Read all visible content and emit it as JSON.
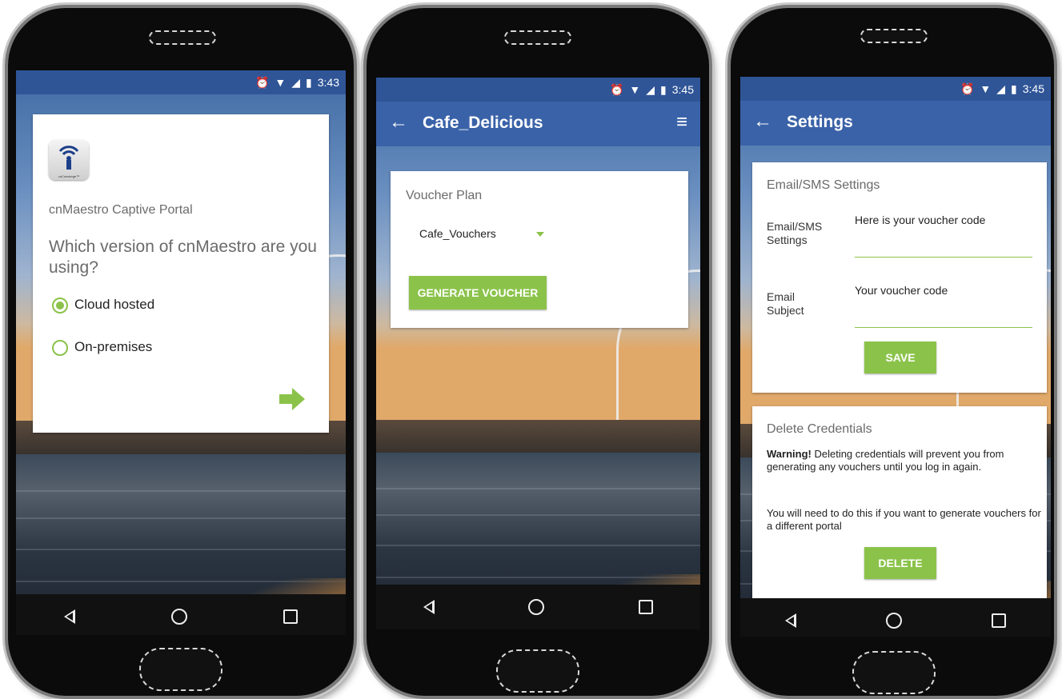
{
  "colors": {
    "app_bar": "#3a62a8",
    "status_bar": "#2f5597",
    "accent_green": "#8bc34a"
  },
  "phone1": {
    "status_time": "3:43",
    "icons": [
      "alarm-icon",
      "wifi-icon",
      "signal-icon",
      "battery-icon"
    ],
    "logo_caption": "cnConcierge™",
    "app_name": "cnMaestro Captive Portal",
    "question": "Which version of cnMaestro are you using?",
    "options": [
      {
        "label": "Cloud hosted",
        "selected": true
      },
      {
        "label": "On-premises",
        "selected": false
      }
    ],
    "next_icon": "arrow-right-icon"
  },
  "phone2": {
    "status_time": "3:45",
    "title": "Cafe_Delicious",
    "section_label": "Voucher Plan",
    "plan_value": "Cafe_Vouchers",
    "generate_label": "GENERATE VOUCHER"
  },
  "phone3": {
    "status_time": "3:45",
    "title": "Settings",
    "email_section_title": "Email/SMS Settings",
    "field1_label": "Email/SMS Settings",
    "field1_value": "Here is your voucher code",
    "field2_label": "Email Subject",
    "field2_value": "Your voucher code",
    "save_label": "SAVE",
    "delete_section_title": "Delete Credentials",
    "warning_bold": "Warning!",
    "warning_text": "Deleting credentials will prevent you from generating any vouchers until you log in again.",
    "info_text": "You will need to do this if you want to generate vouchers for a different portal",
    "delete_label": "DELETE"
  }
}
